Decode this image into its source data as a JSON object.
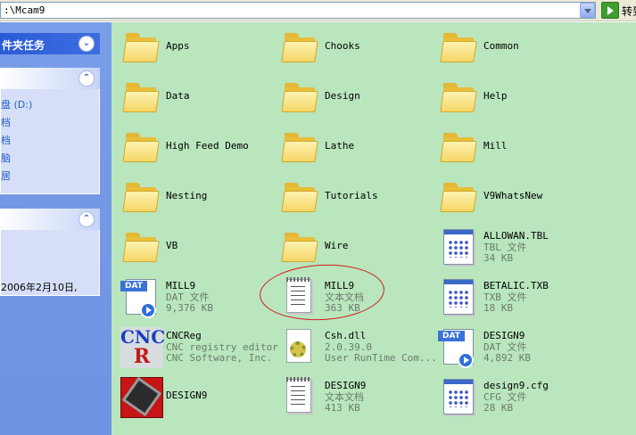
{
  "address_bar": {
    "path": ":\\Mcam9",
    "go_label": "转到"
  },
  "task_pane": {
    "folder_tasks": {
      "title": "件夹任务"
    },
    "other_places": {
      "items": [
        "盘 (D:)",
        "档",
        "档",
        "脑",
        "居"
      ]
    },
    "details": {
      "info": "2006年2月10日,"
    }
  },
  "files": [
    {
      "type": "folder",
      "name": "Apps"
    },
    {
      "type": "folder",
      "name": "Chooks"
    },
    {
      "type": "folder",
      "name": "Common"
    },
    {
      "type": "folder",
      "name": "Data"
    },
    {
      "type": "folder",
      "name": "Design"
    },
    {
      "type": "folder",
      "name": "Help"
    },
    {
      "type": "folder",
      "name": "High Feed Demo"
    },
    {
      "type": "folder",
      "name": "Lathe"
    },
    {
      "type": "folder",
      "name": "Mill"
    },
    {
      "type": "folder",
      "name": "Nesting"
    },
    {
      "type": "folder",
      "name": "Tutorials"
    },
    {
      "type": "folder",
      "name": "V9WhatsNew"
    },
    {
      "type": "folder",
      "name": "VB"
    },
    {
      "type": "folder",
      "name": "Wire"
    },
    {
      "type": "win",
      "name": "ALLOWAN.TBL",
      "line2": "TBL 文件",
      "line3": "34 KB"
    },
    {
      "type": "dat",
      "name": "MILL9",
      "line2": "DAT 文件",
      "line3": "9,376 KB",
      "badge": "DAT"
    },
    {
      "type": "doc",
      "name": "MILL9",
      "line2": "文本文档",
      "line3": "363 KB"
    },
    {
      "type": "win",
      "name": "BETALIC.TXB",
      "line2": "TXB 文件",
      "line3": "18 KB"
    },
    {
      "type": "cnc",
      "name": "CNCReg",
      "line2": "CNC registry editor",
      "line3": "CNC Software, Inc.",
      "logo_top": "CNC",
      "logo_bottom": "R"
    },
    {
      "type": "dll",
      "name": "Csh.dll",
      "line2": "2.0.39.0",
      "line3": "User RunTime Com..."
    },
    {
      "type": "dat",
      "name": "DESIGN9",
      "line2": "DAT 文件",
      "line3": "4,892 KB",
      "badge": "DAT"
    },
    {
      "type": "exe",
      "name": "DESIGN9"
    },
    {
      "type": "doc",
      "name": "DESIGN9",
      "line2": "文本文档",
      "line3": "413 KB"
    },
    {
      "type": "win",
      "name": "design9.cfg",
      "line2": "CFG 文件",
      "line3": "28 KB"
    }
  ]
}
